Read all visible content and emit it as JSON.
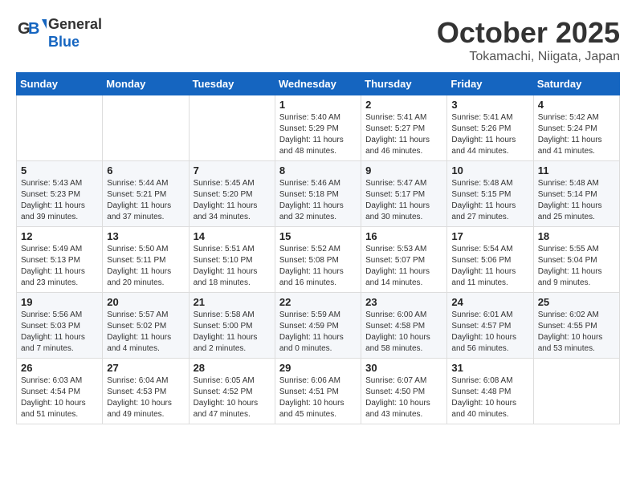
{
  "logo": {
    "line1": "General",
    "line2": "Blue"
  },
  "title": "October 2025",
  "location": "Tokamachi, Niigata, Japan",
  "days_of_week": [
    "Sunday",
    "Monday",
    "Tuesday",
    "Wednesday",
    "Thursday",
    "Friday",
    "Saturday"
  ],
  "weeks": [
    [
      {
        "day": "",
        "info": ""
      },
      {
        "day": "",
        "info": ""
      },
      {
        "day": "",
        "info": ""
      },
      {
        "day": "1",
        "info": "Sunrise: 5:40 AM\nSunset: 5:29 PM\nDaylight: 11 hours\nand 48 minutes."
      },
      {
        "day": "2",
        "info": "Sunrise: 5:41 AM\nSunset: 5:27 PM\nDaylight: 11 hours\nand 46 minutes."
      },
      {
        "day": "3",
        "info": "Sunrise: 5:41 AM\nSunset: 5:26 PM\nDaylight: 11 hours\nand 44 minutes."
      },
      {
        "day": "4",
        "info": "Sunrise: 5:42 AM\nSunset: 5:24 PM\nDaylight: 11 hours\nand 41 minutes."
      }
    ],
    [
      {
        "day": "5",
        "info": "Sunrise: 5:43 AM\nSunset: 5:23 PM\nDaylight: 11 hours\nand 39 minutes."
      },
      {
        "day": "6",
        "info": "Sunrise: 5:44 AM\nSunset: 5:21 PM\nDaylight: 11 hours\nand 37 minutes."
      },
      {
        "day": "7",
        "info": "Sunrise: 5:45 AM\nSunset: 5:20 PM\nDaylight: 11 hours\nand 34 minutes."
      },
      {
        "day": "8",
        "info": "Sunrise: 5:46 AM\nSunset: 5:18 PM\nDaylight: 11 hours\nand 32 minutes."
      },
      {
        "day": "9",
        "info": "Sunrise: 5:47 AM\nSunset: 5:17 PM\nDaylight: 11 hours\nand 30 minutes."
      },
      {
        "day": "10",
        "info": "Sunrise: 5:48 AM\nSunset: 5:15 PM\nDaylight: 11 hours\nand 27 minutes."
      },
      {
        "day": "11",
        "info": "Sunrise: 5:48 AM\nSunset: 5:14 PM\nDaylight: 11 hours\nand 25 minutes."
      }
    ],
    [
      {
        "day": "12",
        "info": "Sunrise: 5:49 AM\nSunset: 5:13 PM\nDaylight: 11 hours\nand 23 minutes."
      },
      {
        "day": "13",
        "info": "Sunrise: 5:50 AM\nSunset: 5:11 PM\nDaylight: 11 hours\nand 20 minutes."
      },
      {
        "day": "14",
        "info": "Sunrise: 5:51 AM\nSunset: 5:10 PM\nDaylight: 11 hours\nand 18 minutes."
      },
      {
        "day": "15",
        "info": "Sunrise: 5:52 AM\nSunset: 5:08 PM\nDaylight: 11 hours\nand 16 minutes."
      },
      {
        "day": "16",
        "info": "Sunrise: 5:53 AM\nSunset: 5:07 PM\nDaylight: 11 hours\nand 14 minutes."
      },
      {
        "day": "17",
        "info": "Sunrise: 5:54 AM\nSunset: 5:06 PM\nDaylight: 11 hours\nand 11 minutes."
      },
      {
        "day": "18",
        "info": "Sunrise: 5:55 AM\nSunset: 5:04 PM\nDaylight: 11 hours\nand 9 minutes."
      }
    ],
    [
      {
        "day": "19",
        "info": "Sunrise: 5:56 AM\nSunset: 5:03 PM\nDaylight: 11 hours\nand 7 minutes."
      },
      {
        "day": "20",
        "info": "Sunrise: 5:57 AM\nSunset: 5:02 PM\nDaylight: 11 hours\nand 4 minutes."
      },
      {
        "day": "21",
        "info": "Sunrise: 5:58 AM\nSunset: 5:00 PM\nDaylight: 11 hours\nand 2 minutes."
      },
      {
        "day": "22",
        "info": "Sunrise: 5:59 AM\nSunset: 4:59 PM\nDaylight: 11 hours\nand 0 minutes."
      },
      {
        "day": "23",
        "info": "Sunrise: 6:00 AM\nSunset: 4:58 PM\nDaylight: 10 hours\nand 58 minutes."
      },
      {
        "day": "24",
        "info": "Sunrise: 6:01 AM\nSunset: 4:57 PM\nDaylight: 10 hours\nand 56 minutes."
      },
      {
        "day": "25",
        "info": "Sunrise: 6:02 AM\nSunset: 4:55 PM\nDaylight: 10 hours\nand 53 minutes."
      }
    ],
    [
      {
        "day": "26",
        "info": "Sunrise: 6:03 AM\nSunset: 4:54 PM\nDaylight: 10 hours\nand 51 minutes."
      },
      {
        "day": "27",
        "info": "Sunrise: 6:04 AM\nSunset: 4:53 PM\nDaylight: 10 hours\nand 49 minutes."
      },
      {
        "day": "28",
        "info": "Sunrise: 6:05 AM\nSunset: 4:52 PM\nDaylight: 10 hours\nand 47 minutes."
      },
      {
        "day": "29",
        "info": "Sunrise: 6:06 AM\nSunset: 4:51 PM\nDaylight: 10 hours\nand 45 minutes."
      },
      {
        "day": "30",
        "info": "Sunrise: 6:07 AM\nSunset: 4:50 PM\nDaylight: 10 hours\nand 43 minutes."
      },
      {
        "day": "31",
        "info": "Sunrise: 6:08 AM\nSunset: 4:48 PM\nDaylight: 10 hours\nand 40 minutes."
      },
      {
        "day": "",
        "info": ""
      }
    ]
  ]
}
